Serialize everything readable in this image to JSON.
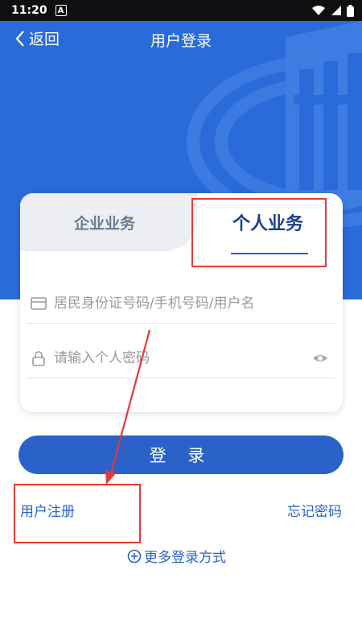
{
  "status_bar": {
    "time": "11:20",
    "notification_badge": "A"
  },
  "header": {
    "back_label": "返回",
    "title": "用户登录"
  },
  "tabs": {
    "enterprise": "企业业务",
    "personal": "个人业务",
    "active": "personal"
  },
  "form": {
    "username_placeholder": "居民身份证号码/手机号码/用户名",
    "password_placeholder": "请输入个人密码"
  },
  "login_button": "登 录",
  "links": {
    "register": "用户注册",
    "forgot": "忘记密码",
    "more_login": "更多登录方式"
  },
  "colors": {
    "primary": "#2a62c9",
    "hero": "#2a6bd9",
    "annotation": "#e53935"
  },
  "icons": [
    "back-arrow-icon",
    "wifi-icon",
    "signal-icon",
    "battery-icon",
    "id-card-icon",
    "lock-icon",
    "eye-icon",
    "plus-circle-icon"
  ]
}
